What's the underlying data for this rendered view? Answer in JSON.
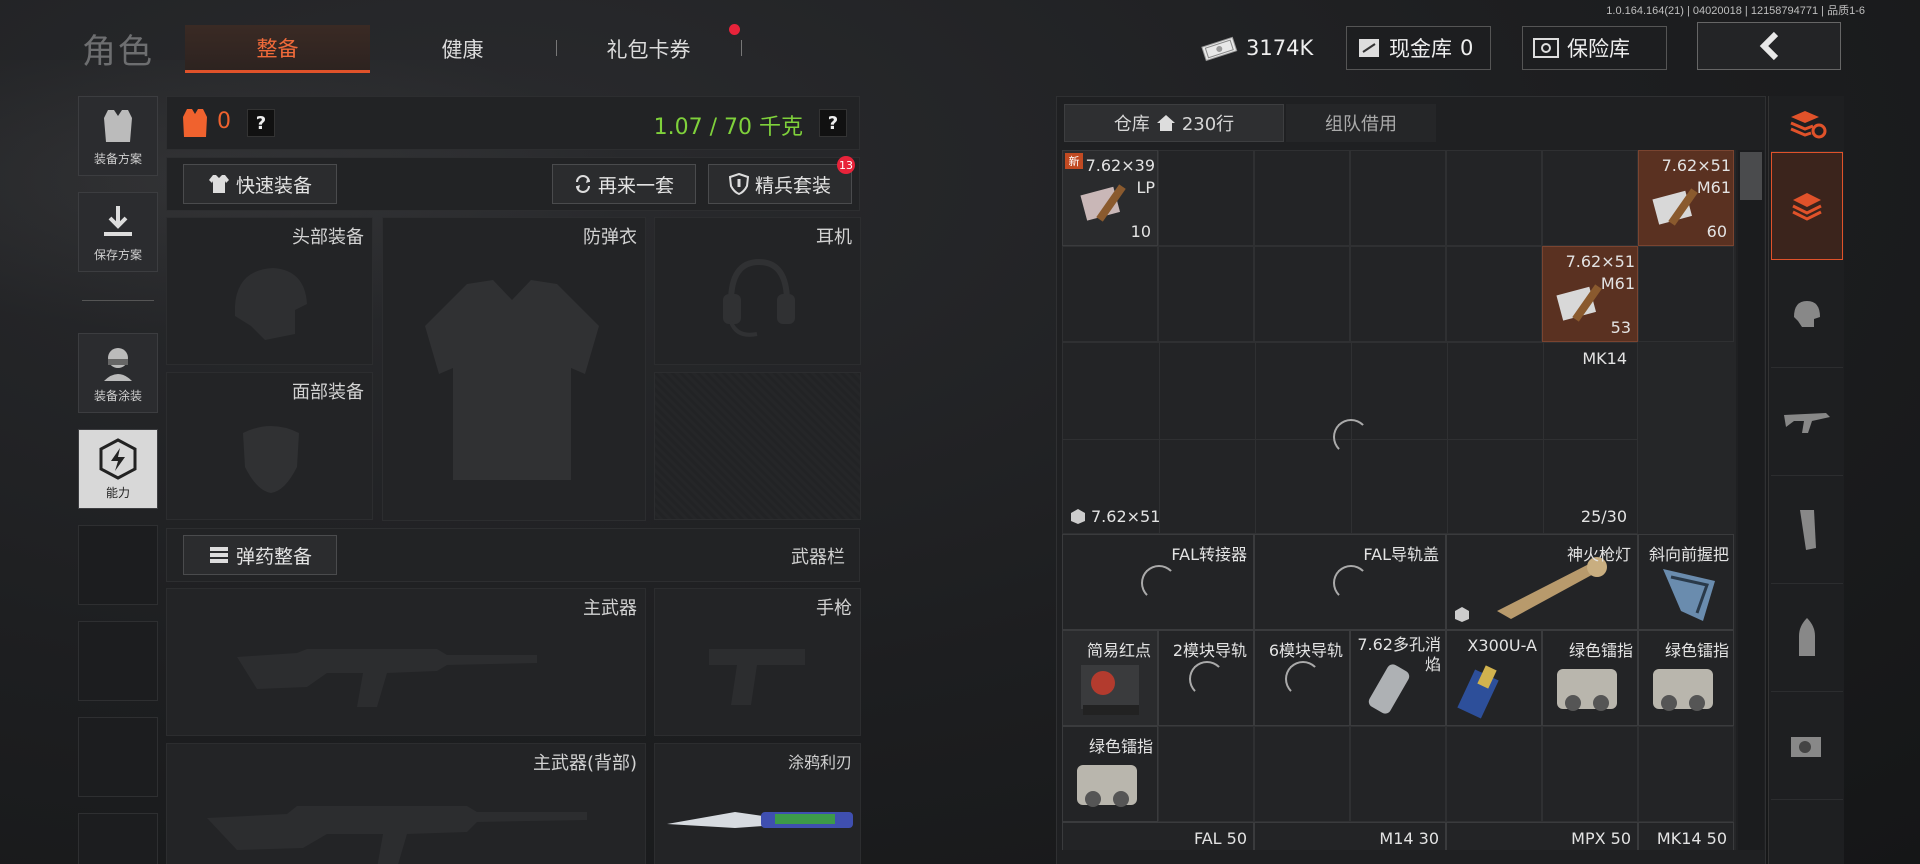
{
  "version_text": "1.0.164.164(21) | 04020018 | 12158794771 | 品质1-6",
  "title": "角色",
  "tabs": [
    {
      "label": "整备",
      "active": true
    },
    {
      "label": "健康",
      "active": false
    },
    {
      "label": "礼包卡券",
      "active": false,
      "has_dot": true
    }
  ],
  "currency": {
    "money": "3174K",
    "cash_vault_label": "现金库",
    "cash_vault_value": "0",
    "insurance_label": "保险库"
  },
  "left_nav": [
    {
      "label": "装备方案",
      "icon": "vest-icon"
    },
    {
      "label": "保存方案",
      "icon": "download-icon"
    },
    {
      "label": "装备涂装",
      "icon": "soldier-icon"
    },
    {
      "label": "能力",
      "icon": "ability-icon",
      "selected": true
    }
  ],
  "loadout": {
    "armor_count": "0",
    "help": "?",
    "weight": "1.07 / 70 千克",
    "quick_equip": "快速装备",
    "refresh": "再来一套",
    "elite_set": "精兵套装",
    "elite_badge": "13",
    "slots": {
      "head": "头部装备",
      "body": "防弹衣",
      "ear": "耳机",
      "face": "面部装备",
      "primary": "主武器",
      "pistol": "手枪",
      "primary_back": "主武器(背部)",
      "melee": "涂鸦利刃"
    },
    "ammo_equip": "弹药整备",
    "weapon_bar": "武器栏"
  },
  "storage": {
    "tab_storage": "仓库",
    "rows": "230行",
    "tab_team": "组队借用",
    "items": [
      {
        "name": "7.62×39 LP",
        "count": "10",
        "new": "新"
      },
      {
        "name": "7.62×51 M61",
        "count": "60"
      },
      {
        "name": "7.62×51 M61",
        "count": "53"
      },
      {
        "name": "MK14",
        "ammo": "7.62×51",
        "mag": "25/30"
      },
      {
        "name": "FAL转接器"
      },
      {
        "name": "FAL导轨盖"
      },
      {
        "name": "神火枪灯"
      },
      {
        "name": "斜向前握把"
      },
      {
        "name": "简易红点"
      },
      {
        "name": "2模块导轨"
      },
      {
        "name": "6模块导轨"
      },
      {
        "name": "7.62多孔消焰"
      },
      {
        "name": "X300U-A"
      },
      {
        "name": "绿色镭指"
      },
      {
        "name": "绿色镭指"
      },
      {
        "name": "绿色镭指"
      },
      {
        "name": "FAL 50"
      },
      {
        "name": "M14 30"
      },
      {
        "name": "MPX 50"
      },
      {
        "name": "MK14 50"
      }
    ]
  },
  "colors": {
    "accent": "#e0522a",
    "weight_green": "#7fd13b",
    "highlight_item": "#5a3121"
  }
}
